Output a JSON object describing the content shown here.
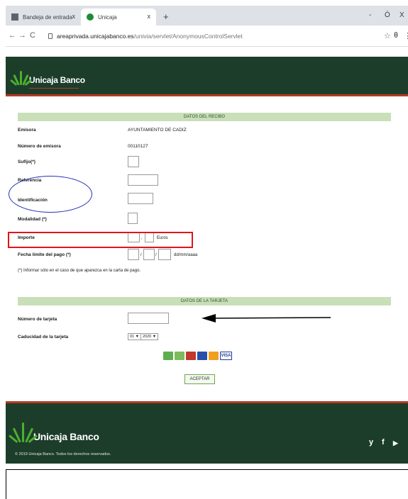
{
  "browser": {
    "tabs": [
      {
        "label": "Bandeja de entrada",
        "close": "x",
        "icon": "mail-icon"
      },
      {
        "label": "Unicaja",
        "close": "x",
        "icon": "unicaja-icon"
      }
    ],
    "new_tab": "+",
    "window_controls": {
      "minimize": "-",
      "maximize": "Ò",
      "close": "X"
    },
    "nav": {
      "back": "←",
      "forward": "→",
      "reload": "C"
    },
    "url_host": "areaprivada.unicajabanco.es",
    "url_path": "/univia/servlet/AnonymousControlServlet",
    "star": "☆",
    "profile": "θ",
    "menu": "⋮"
  },
  "header": {
    "brand": "Unicaja Banco"
  },
  "receipt": {
    "section_title": "DATOS DEL RECIBO",
    "emisora_label": "Emisora",
    "emisora_value": "AYUNTAMIENTO DE CADIZ",
    "numero_emisora_label": "Número de emisora",
    "numero_emisora_value": "00110127",
    "sufijo_label": "Sufijo(*)",
    "referencia_label": "Referencia",
    "identificacion_label": "Identificación",
    "modalidad_label": "Modalidad (*)",
    "importe_label": "Importe",
    "importe_sep": ",",
    "importe_unit": "Euros",
    "fecha_label": "Fecha límite del pago (*)",
    "fecha_sep": "/",
    "fecha_format": "dd/mm/aaaa",
    "note": "(*) Informar sólo en el caso de que aparezca en la carta de pago."
  },
  "card": {
    "section_title": "DATOS DE LA TARJETA",
    "numero_label": "Número de tarjeta",
    "caducidad_label": "Caducidad de la tarjeta",
    "month": "01 ▼",
    "year": "2020 ▼",
    "visa_label": "VISA",
    "submit_label": "ACEPTAR"
  },
  "footer": {
    "brand": "Unicaja Banco",
    "copyright": "© 2019 Unicaja Banco. Todos los derechos reservados.",
    "social": [
      "y",
      "f",
      "▶"
    ]
  },
  "colors": {
    "brand_green": "#1d3d2b",
    "accent_red": "#b43a26",
    "section_bar": "#c8dfb8",
    "annotation_blue": "#2632b8",
    "annotation_red": "#e0151a"
  }
}
